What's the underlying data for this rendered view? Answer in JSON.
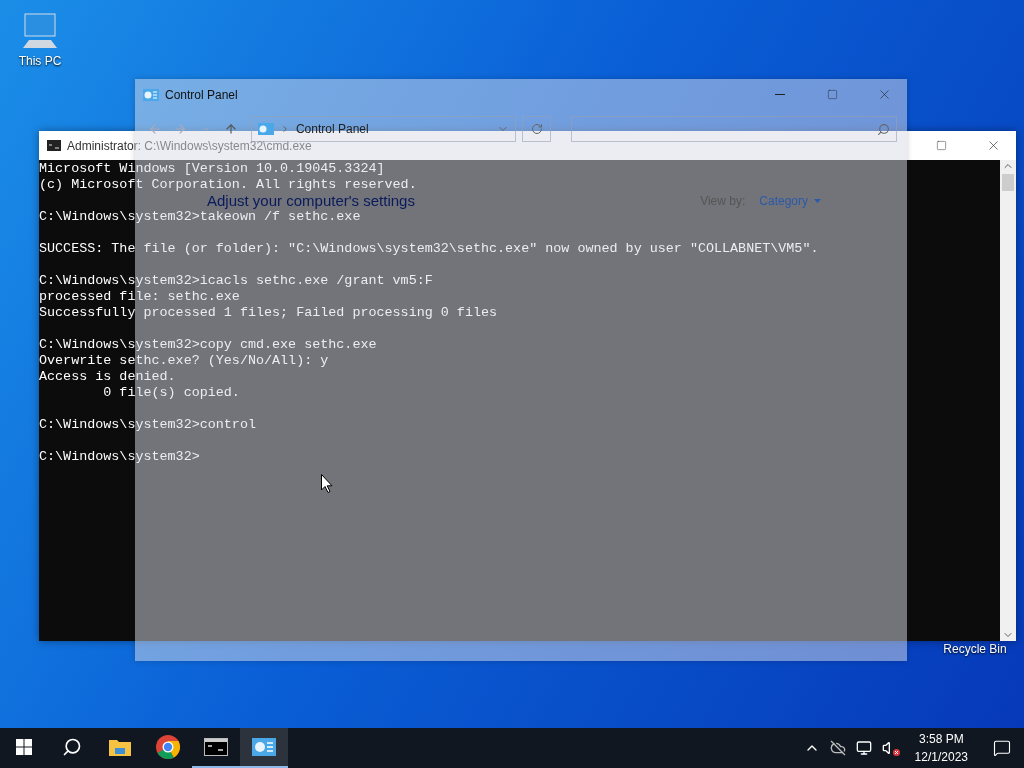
{
  "desktop_icons": [
    {
      "kind": "computer",
      "label": "This PC"
    },
    {
      "kind": "recycle-bin",
      "label": "Recycle Bin"
    }
  ],
  "cmd_window": {
    "title": "Administrator: C:\\Windows\\system32\\cmd.exe",
    "blocks": [
      [
        "Microsoft Windows [Version 10.0.19045.3324]",
        "(c) Microsoft Corporation. All rights reserved."
      ],
      [
        "C:\\Windows\\system32>takeown /f sethc.exe"
      ],
      [
        "SUCCESS: The file (or folder): \"C:\\Windows\\system32\\sethc.exe\" now owned by user \"COLLABNET\\VM5\"."
      ],
      [
        "C:\\Windows\\system32>icacls sethc.exe /grant vm5:F",
        "processed file: sethc.exe",
        "Successfully processed 1 files; Failed processing 0 files"
      ],
      [
        "C:\\Windows\\system32>copy cmd.exe sethc.exe",
        "Overwrite sethc.exe? (Yes/No/All): y",
        "Access is denied.",
        "        0 file(s) copied."
      ],
      [
        "C:\\Windows\\system32>control"
      ],
      [
        "C:\\Windows\\system32>"
      ]
    ]
  },
  "control_panel": {
    "title": "Control Panel",
    "address": "Control Panel",
    "heading": "Adjust your computer's settings",
    "view_by_label": "View by:",
    "view_by_value": "Category"
  },
  "taskbar": {
    "apps": [
      {
        "kind": "explorer",
        "open": false,
        "selected": false
      },
      {
        "kind": "chrome",
        "open": false,
        "selected": false
      },
      {
        "kind": "terminal",
        "open": true,
        "selected": false
      },
      {
        "kind": "control-panel",
        "open": true,
        "selected": true
      }
    ],
    "time": "3:58 PM",
    "date": "12/1/2023"
  }
}
